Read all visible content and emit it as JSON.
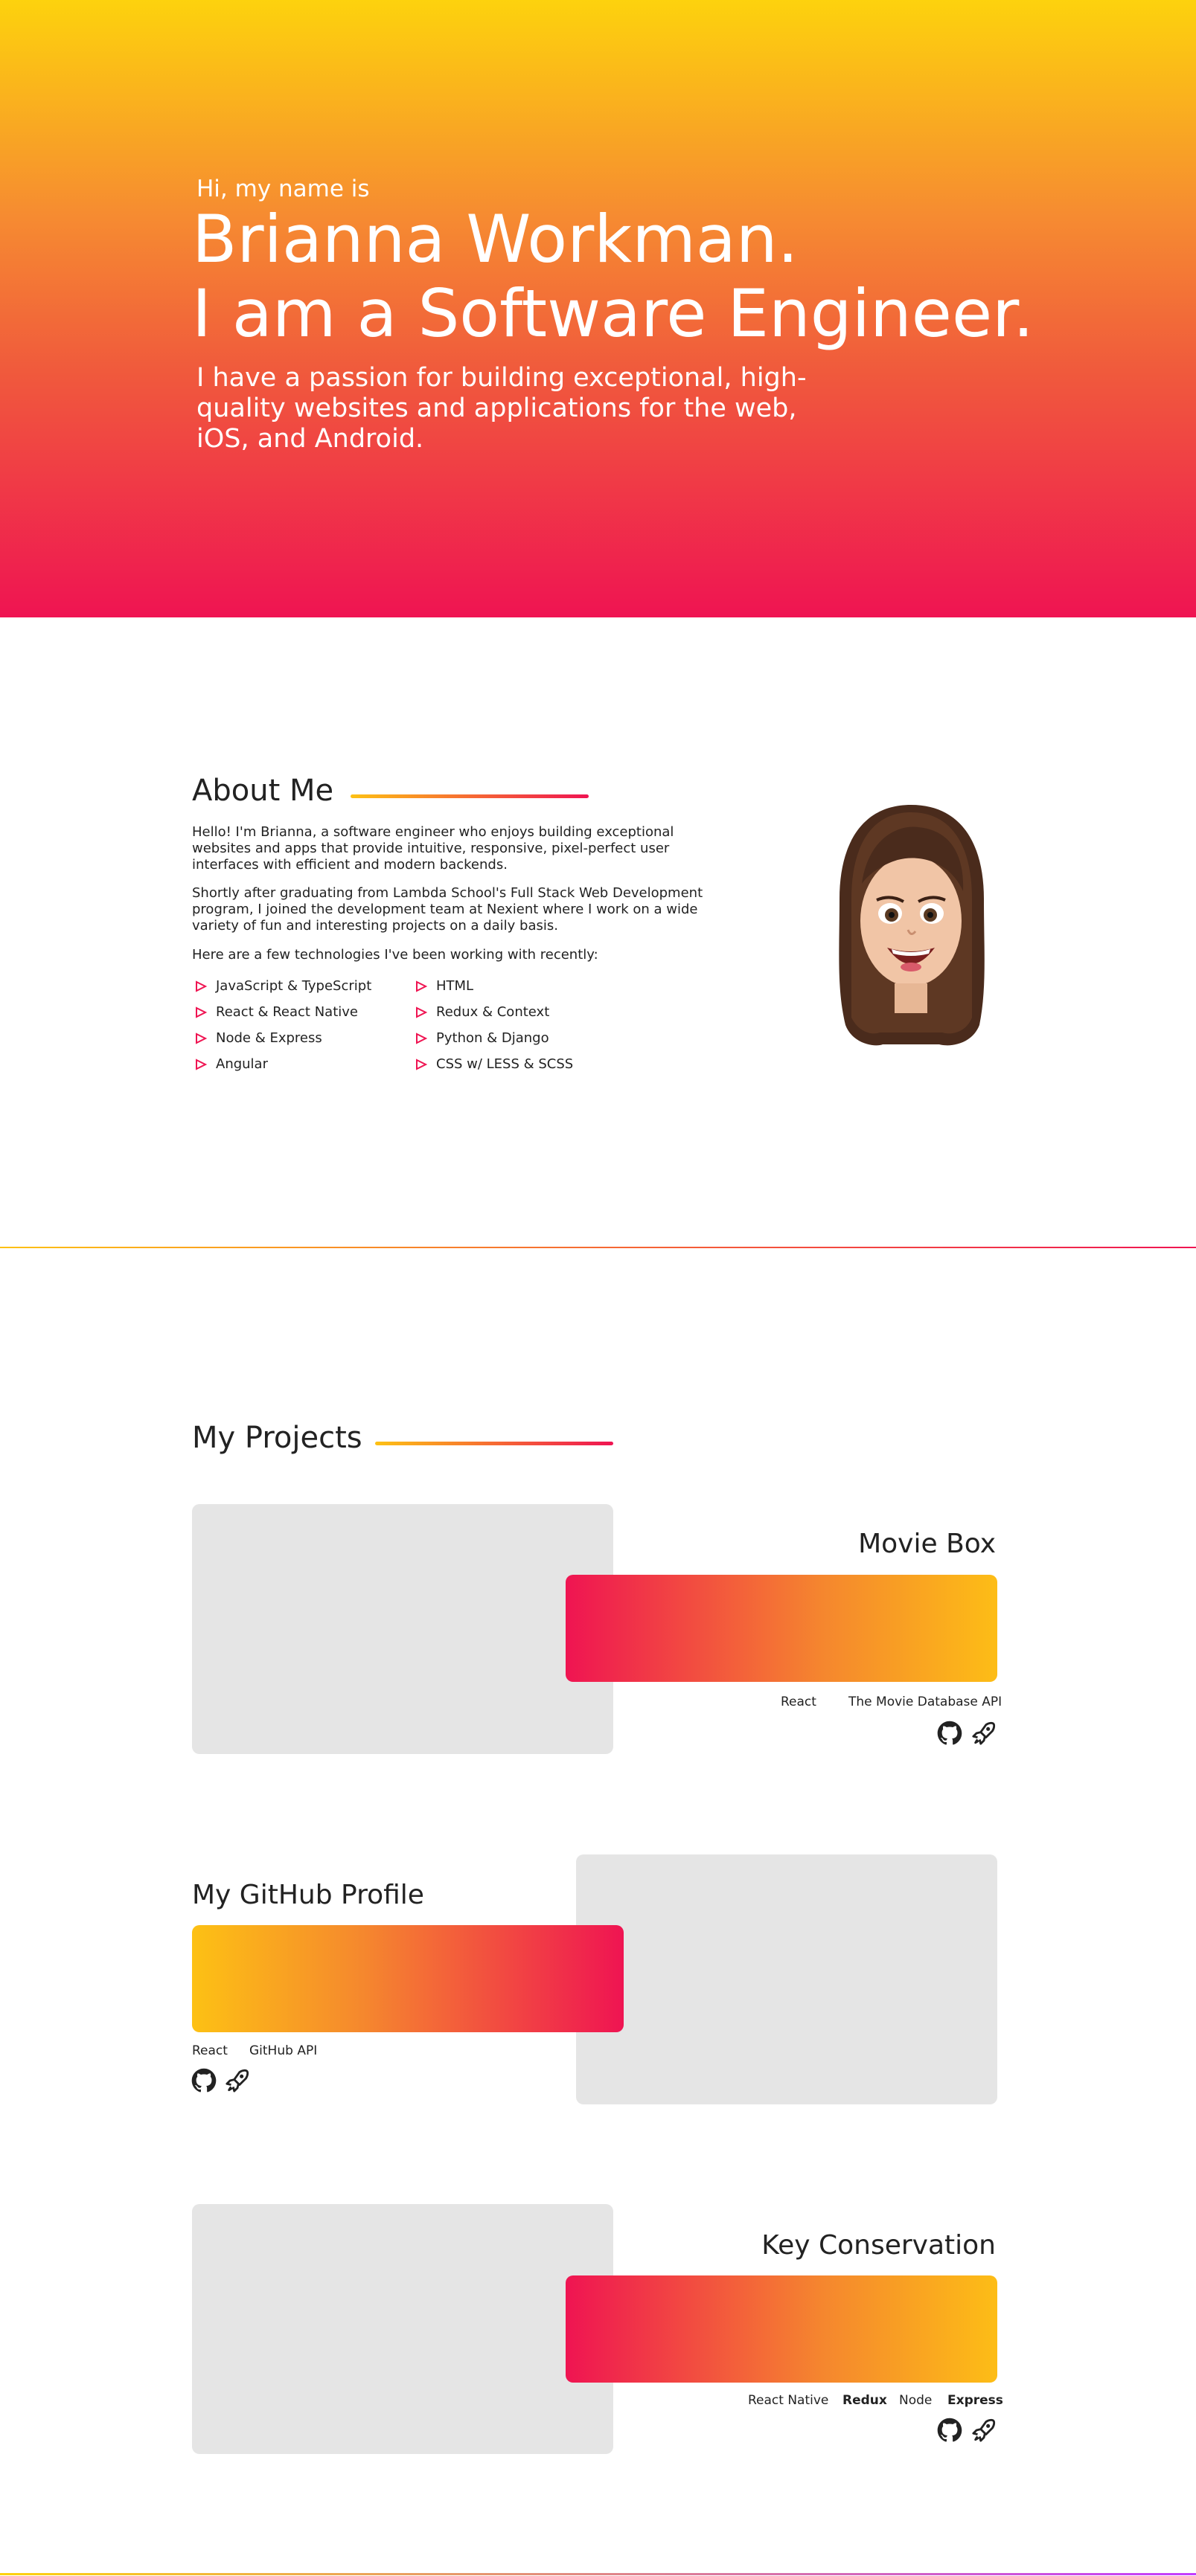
{
  "hero": {
    "greeting": "Hi, my name is",
    "name_line1": "Brianna Workman.",
    "name_line2": "I am a Software Engineer.",
    "subtitle": "I have a passion for building exceptional, high-quality websites and applications for the web, iOS, and Android."
  },
  "about": {
    "title": "About Me",
    "paragraphs": [
      "Hello! I'm Brianna, a software engineer who enjoys building exceptional websites and apps that provide intuitive, responsive, pixel-perfect user interfaces with efficient and modern backends.",
      "Shortly after graduating from Lambda School's Full Stack Web Development program, I joined the development team at Nexient where I work on a wide variety of fun and interesting projects on a daily basis.",
      "Here are a few technologies I've been working with recently:"
    ],
    "technologies": [
      "JavaScript & TypeScript",
      "React & React Native",
      "Node & Express",
      "Angular",
      "HTML",
      "Redux & Context",
      "Python & Django",
      "CSS w/ LESS & SCSS"
    ],
    "avatar_icon": "memoji-avatar"
  },
  "projects": {
    "title": "My Projects",
    "items": [
      {
        "title": "Movie Box",
        "tags": [
          "React",
          "The Movie Database API"
        ],
        "icons": [
          "github-icon",
          "rocket-icon"
        ]
      },
      {
        "title": "My GitHub Profile",
        "tags": [
          "React",
          "GitHub API"
        ],
        "icons": [
          "github-icon",
          "rocket-icon"
        ]
      },
      {
        "title": "Key Conservation",
        "tags": [
          "React Native",
          "Redux",
          "Node",
          "Express"
        ],
        "icons": [
          "github-icon",
          "rocket-icon"
        ]
      }
    ]
  },
  "colors": {
    "hero_top": "#fdd20d",
    "hero_bottom": "#ef1452",
    "accent_pink": "#ef1452",
    "accent_yellow": "#fdc114",
    "placeholder_gray": "#e5e5e5"
  }
}
